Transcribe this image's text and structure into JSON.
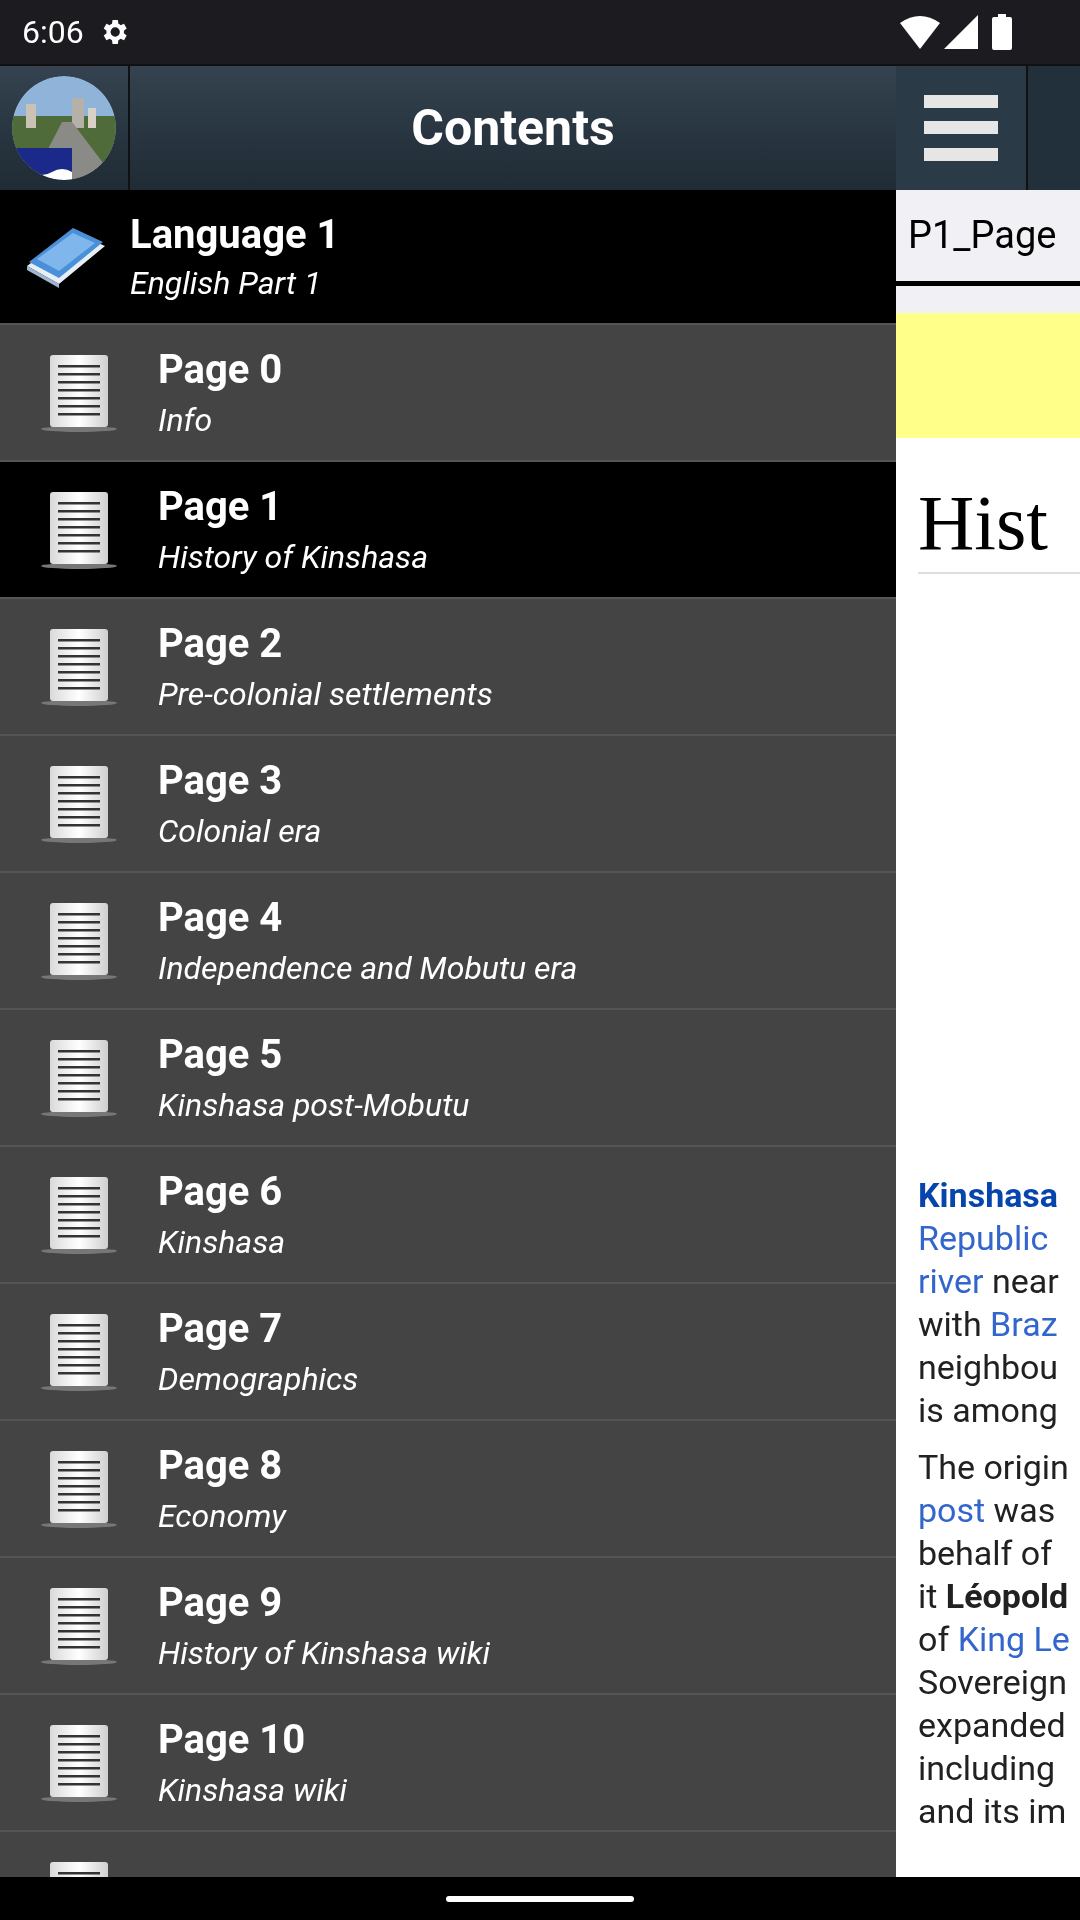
{
  "status_bar": {
    "time": "6:06"
  },
  "drawer": {
    "title": "Contents",
    "group": {
      "title": "Language 1",
      "subtitle": "English Part 1"
    },
    "items": [
      {
        "title": "Page 0",
        "subtitle": "Info",
        "selected": false
      },
      {
        "title": "Page 1",
        "subtitle": "History of Kinshasa",
        "selected": true
      },
      {
        "title": "Page 2",
        "subtitle": "Pre-colonial settlements",
        "selected": false
      },
      {
        "title": "Page 3",
        "subtitle": "Colonial era",
        "selected": false
      },
      {
        "title": "Page 4",
        "subtitle": "Independence and Mobutu era",
        "selected": false
      },
      {
        "title": "Page 5",
        "subtitle": "Kinshasa post-Mobutu",
        "selected": false
      },
      {
        "title": "Page 6",
        "subtitle": "Kinshasa",
        "selected": false
      },
      {
        "title": "Page 7",
        "subtitle": "Demographics",
        "selected": false
      },
      {
        "title": "Page 8",
        "subtitle": "Economy",
        "selected": false
      },
      {
        "title": "Page 9",
        "subtitle": "History of Kinshasa wiki",
        "selected": false
      },
      {
        "title": "Page 10",
        "subtitle": "Kinshasa wiki",
        "selected": false
      },
      {
        "selected": false
      }
    ]
  },
  "content": {
    "tab": "P1_Page",
    "heading": "Hist",
    "paragraphs": [
      [
        [
          {
            "kind": "bold_link",
            "text": "Kinshasa"
          }
        ],
        [
          {
            "kind": "link",
            "text": "Republic"
          }
        ],
        [
          {
            "kind": "link",
            "text": "river"
          },
          {
            "kind": "text",
            "text": " near"
          }
        ],
        [
          {
            "kind": "text",
            "text": "with "
          },
          {
            "kind": "link",
            "text": "Braz"
          }
        ],
        [
          {
            "kind": "text",
            "text": "neighbou"
          }
        ],
        [
          {
            "kind": "text",
            "text": "is among"
          }
        ]
      ],
      [
        [
          {
            "kind": "text",
            "text": "The origin"
          }
        ],
        [
          {
            "kind": "link",
            "text": "post"
          },
          {
            "kind": "text",
            "text": " was"
          }
        ],
        [
          {
            "kind": "text",
            "text": "behalf of"
          }
        ],
        [
          {
            "kind": "text",
            "text": "it "
          },
          {
            "kind": "bold",
            "text": "Léopold"
          }
        ],
        [
          {
            "kind": "text",
            "text": "of "
          },
          {
            "kind": "link",
            "text": "King Le"
          }
        ],
        [
          {
            "kind": "text",
            "text": "Sovereign"
          }
        ],
        [
          {
            "kind": "text",
            "text": "expanded"
          }
        ],
        [
          {
            "kind": "text",
            "text": "including"
          }
        ],
        [
          {
            "kind": "text",
            "text": "and its im"
          }
        ]
      ]
    ]
  }
}
